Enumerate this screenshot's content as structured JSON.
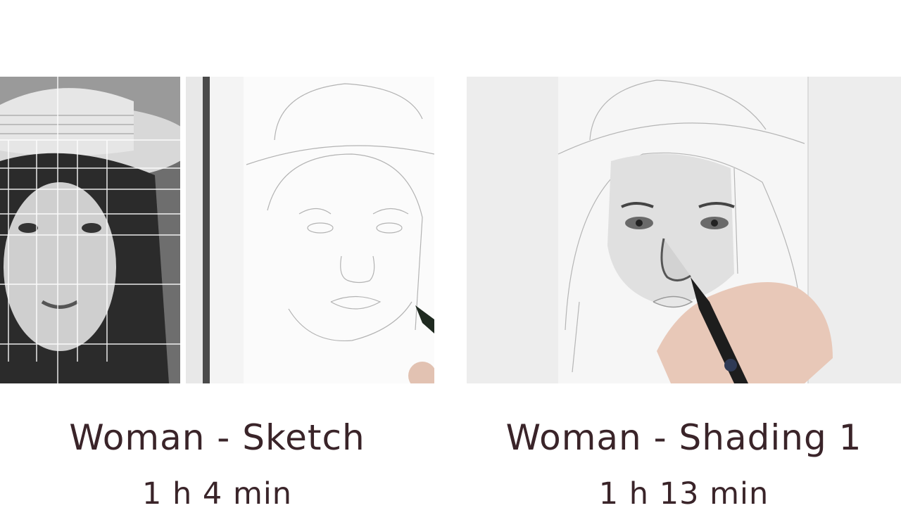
{
  "lessons": [
    {
      "title": "Woman - Sketch",
      "duration": "1 h 4 min"
    },
    {
      "title": "Woman - Shading 1",
      "duration": "1 h 13 min"
    }
  ],
  "colors": {
    "text": "#3a2429",
    "background": "#ffffff"
  }
}
